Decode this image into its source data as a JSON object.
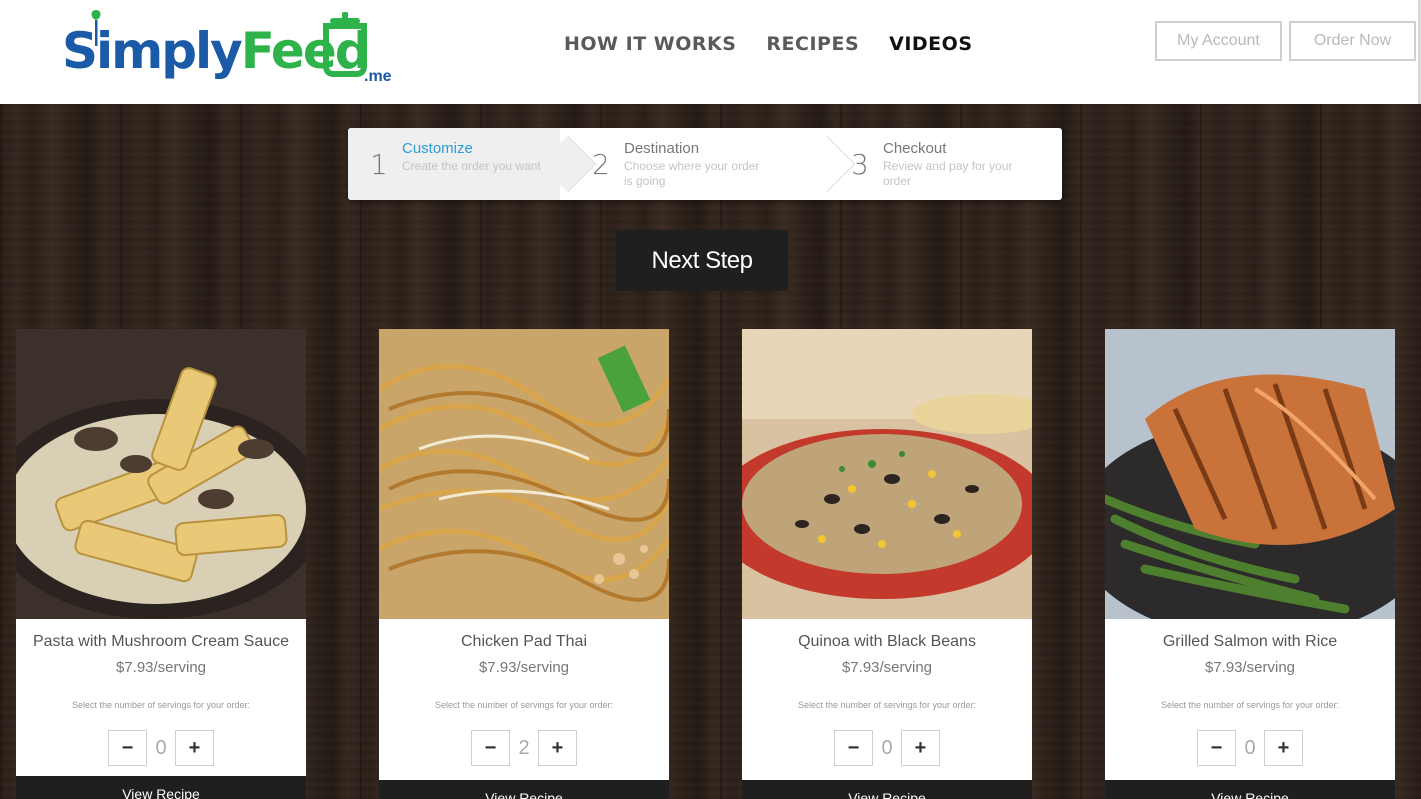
{
  "brand": {
    "name_part1": "Simply",
    "name_part2": "Feed",
    "suffix": ".me",
    "colors": {
      "blue": "#1a5aa6",
      "green": "#2db34a"
    }
  },
  "nav": {
    "items": [
      {
        "label": "HOW IT WORKS",
        "active": false
      },
      {
        "label": "RECIPES",
        "active": false
      },
      {
        "label": "VIDEOS",
        "active": true
      }
    ]
  },
  "header_buttons": {
    "account": "My Account",
    "order": "Order Now"
  },
  "steps": [
    {
      "number": "1",
      "title": "Customize",
      "desc": "Create the order you want",
      "active": true
    },
    {
      "number": "2",
      "title": "Destination",
      "desc": "Choose where your order is going",
      "active": false
    },
    {
      "number": "3",
      "title": "Checkout",
      "desc": "Review and pay for your order",
      "active": false
    }
  ],
  "next_step": "Next Step",
  "cards": [
    {
      "title": "Pasta with Mushroom Cream Sauce",
      "price": "$7.93/serving",
      "hint": "Select the number of servings for your order:",
      "minus": "−",
      "plus": "+",
      "count": "0",
      "cta": "View Recipe",
      "image_icon": "pasta-photo"
    },
    {
      "title": "Chicken Pad Thai",
      "price": "$7.93/serving",
      "hint": "Select the number of servings for your order:",
      "minus": "−",
      "plus": "+",
      "count": "2",
      "cta": "View Recipe",
      "image_icon": "pad-thai-photo"
    },
    {
      "title": "Quinoa with Black Beans",
      "price": "$7.93/serving",
      "hint": "Select the number of servings for your order:",
      "minus": "−",
      "plus": "+",
      "count": "0",
      "cta": "View Recipe",
      "image_icon": "quinoa-photo"
    },
    {
      "title": "Grilled Salmon with Rice",
      "price": "$7.93/serving",
      "hint": "Select the number of servings for your order:",
      "minus": "−",
      "plus": "+",
      "count": "0",
      "cta": "View Recipe",
      "image_icon": "salmon-photo"
    }
  ]
}
